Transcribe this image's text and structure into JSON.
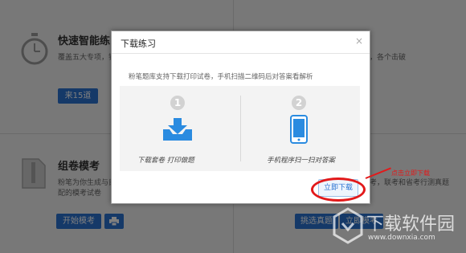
{
  "background": {
    "quick_practice": {
      "title": "快速智能练习",
      "desc": "覆盖五大专项，针",
      "desc_right": "，各个击破",
      "button": "来15道"
    },
    "compose": {
      "title": "组卷模考",
      "desc_line1": "粉笔为你生成与目",
      "desc_line2": "配的模考试卷",
      "desc_right": "考，联考和省考行测真题",
      "start_button": "开始模考",
      "print_icon": "printer-icon",
      "choose_button": "挑选真题",
      "now_button": "立即模考"
    }
  },
  "dialog": {
    "title": "下载练习",
    "close": "×",
    "description": "粉笔题库支持下载打印试卷，手机扫描二维码后对答案看解析",
    "steps": [
      {
        "number": "1",
        "label": "下载套卷 打印做题",
        "icon": "download-tray-icon"
      },
      {
        "number": "2",
        "label": "手机程序扫一扫对答案",
        "icon": "mobile-phone-icon"
      }
    ],
    "download_button": "立即下载"
  },
  "annotation": {
    "text": "点击立即下载",
    "color": "#e2191a"
  },
  "watermark": {
    "name": "下载软件园",
    "url": "www.downxia.com"
  },
  "colors": {
    "accent": "#2a73d1",
    "annotation": "#e2191a"
  }
}
